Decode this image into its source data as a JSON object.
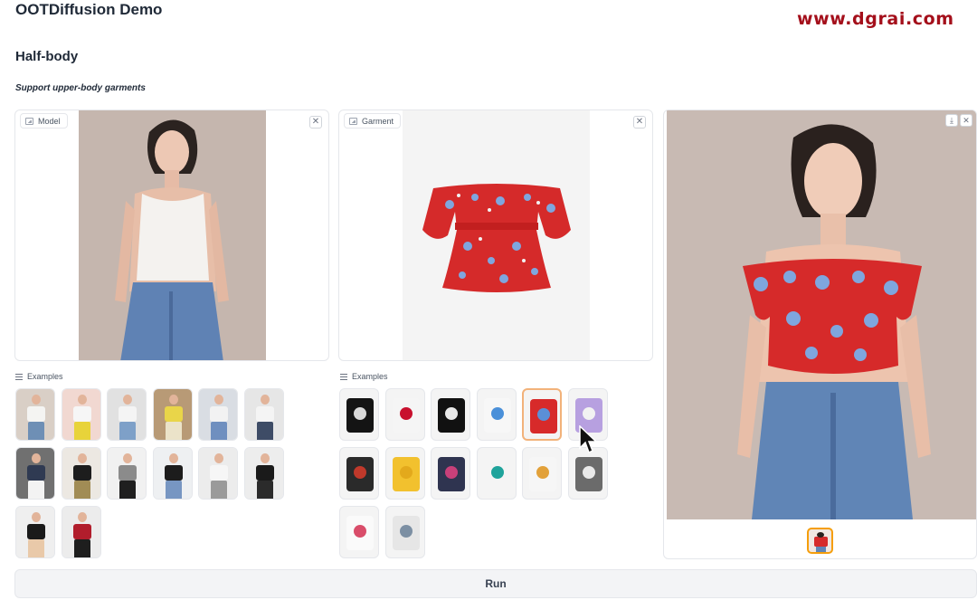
{
  "app": {
    "title": "OOTDiffusion Demo",
    "watermark": "www.dgrai.com"
  },
  "section": {
    "title": "Half-body",
    "subtitle": "Support upper-body garments"
  },
  "model_panel": {
    "label": "Model",
    "close_icon": "close-icon"
  },
  "garment_panel": {
    "label": "Garment",
    "close_icon": "close-icon"
  },
  "output_panel": {
    "download_icon": "download-icon",
    "close_icon": "close-icon"
  },
  "model_examples": {
    "label": "Examples",
    "items": [
      {
        "top": "#f4f4f2",
        "bottom": "#6e8fb5",
        "bg": "#d9cfc6"
      },
      {
        "top": "#f6f6f6",
        "bottom": "#e8d33a",
        "bg": "#f1d8d1"
      },
      {
        "top": "#f4f4f4",
        "bottom": "#7ea0c8",
        "bg": "#e1e1e1"
      },
      {
        "top": "#e9d549",
        "bottom": "#ebe3c9",
        "bg": "#b89a76"
      },
      {
        "top": "#f2f2f2",
        "bottom": "#6f8fbf",
        "bg": "#d9dde3"
      },
      {
        "top": "#f4f4f4",
        "bottom": "#3e4c66",
        "bg": "#e6e6e6"
      },
      {
        "top": "#2f3a52",
        "bottom": "#f3f3f3",
        "bg": "#707070"
      },
      {
        "top": "#1d1d1d",
        "bottom": "#a18c55",
        "bg": "#ece8e2"
      },
      {
        "top": "#8b8b8b",
        "bottom": "#1f1f1f",
        "bg": "#f1f1f1"
      },
      {
        "top": "#1c1c1c",
        "bottom": "#7796c2",
        "bg": "#eef0f2"
      },
      {
        "top": "#f6f6f6",
        "bottom": "#9a9a9a",
        "bg": "#ececec"
      },
      {
        "top": "#1a1a1a",
        "bottom": "#2b2b2b",
        "bg": "#ededed"
      },
      {
        "top": "#1a1a1a",
        "bottom": "#e9c9a9",
        "bg": "#efefef"
      },
      {
        "top": "#b11d2c",
        "bottom": "#1e1e1e",
        "bg": "#ececec"
      }
    ]
  },
  "garment_examples": {
    "label": "Examples",
    "items": [
      {
        "color": "#141414",
        "accent": "#d9d9d9"
      },
      {
        "color": "#f5f5f5",
        "accent": "#c8102e"
      },
      {
        "color": "#111111",
        "accent": "#e8e8e8"
      },
      {
        "color": "#f7f7f7",
        "accent": "#4a90d9"
      },
      {
        "color": "#d72a2a",
        "accent": "#5b8fd6",
        "selected": true
      },
      {
        "color": "#b7a0e0",
        "accent": "#f2f2f2"
      },
      {
        "color": "#2a2a2a",
        "accent": "#c0392b"
      },
      {
        "color": "#f2c12e",
        "accent": "#e3a91c"
      },
      {
        "color": "#2f3450",
        "accent": "#c8407a"
      },
      {
        "color": "#f4f4f4",
        "accent": "#1fa39b"
      },
      {
        "color": "#f6f6f6",
        "accent": "#e2a13a"
      },
      {
        "color": "#6b6b6b",
        "accent": "#e9e9e9"
      },
      {
        "color": "#fafafa",
        "accent": "#d94d6a"
      },
      {
        "color": "#e6e6e6",
        "accent": "#7c8fa3"
      }
    ]
  },
  "run_button": {
    "label": "Run"
  },
  "colors": {
    "accent_border": "#f59e0b",
    "watermark": "#a40f1b",
    "garment_red": "#d52a2a"
  }
}
